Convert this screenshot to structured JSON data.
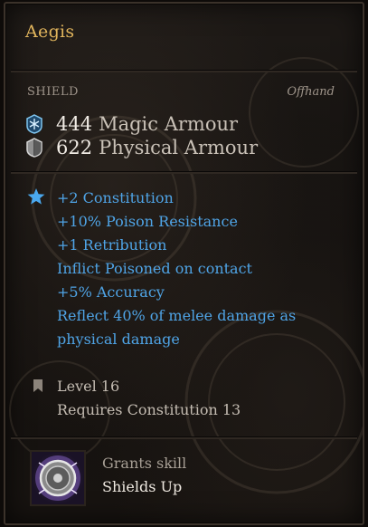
{
  "item": {
    "name": "Aegis",
    "type": "SHIELD",
    "slot": "Offhand"
  },
  "armour": [
    {
      "value": "444",
      "label": "Magic Armour",
      "icon": "magic-armour-icon"
    },
    {
      "value": "622",
      "label": "Physical Armour",
      "icon": "physical-armour-icon"
    }
  ],
  "stats": [
    "+2  Constitution",
    "+10%  Poison Resistance",
    "+1  Retribution",
    "Inflict Poisoned on contact",
    "+5%  Accuracy",
    "Reflect 40% of melee damage as",
    "physical damage"
  ],
  "requirements": {
    "level": "Level  16",
    "requires": "Requires Constitution 13"
  },
  "skill": {
    "label": "Grants skill",
    "name": "Shields Up",
    "icon": "shield-skill-icon"
  },
  "colors": {
    "title": "#e0b45c",
    "stat_blue": "#4fa4e6",
    "text_light": "#f1ece5",
    "text_muted": "#9e948a"
  }
}
